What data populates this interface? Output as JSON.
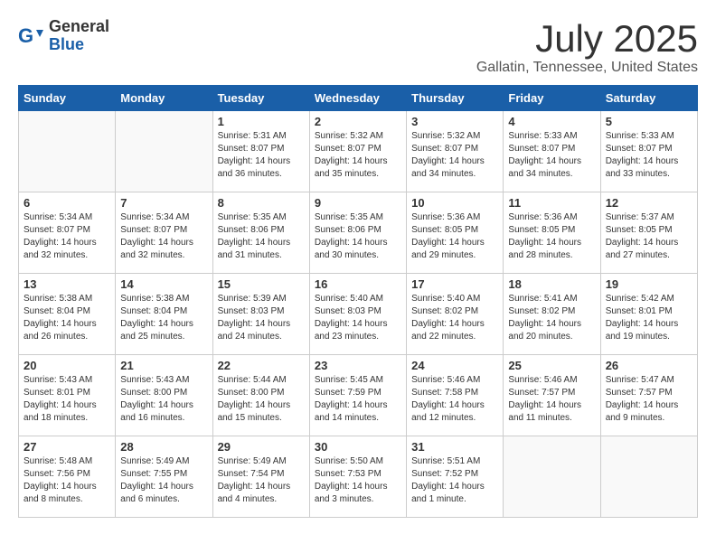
{
  "header": {
    "logo_general": "General",
    "logo_blue": "Blue",
    "month_year": "July 2025",
    "location": "Gallatin, Tennessee, United States"
  },
  "days_of_week": [
    "Sunday",
    "Monday",
    "Tuesday",
    "Wednesday",
    "Thursday",
    "Friday",
    "Saturday"
  ],
  "weeks": [
    [
      {
        "day": "",
        "detail": ""
      },
      {
        "day": "",
        "detail": ""
      },
      {
        "day": "1",
        "detail": "Sunrise: 5:31 AM\nSunset: 8:07 PM\nDaylight: 14 hours and 36 minutes."
      },
      {
        "day": "2",
        "detail": "Sunrise: 5:32 AM\nSunset: 8:07 PM\nDaylight: 14 hours and 35 minutes."
      },
      {
        "day": "3",
        "detail": "Sunrise: 5:32 AM\nSunset: 8:07 PM\nDaylight: 14 hours and 34 minutes."
      },
      {
        "day": "4",
        "detail": "Sunrise: 5:33 AM\nSunset: 8:07 PM\nDaylight: 14 hours and 34 minutes."
      },
      {
        "day": "5",
        "detail": "Sunrise: 5:33 AM\nSunset: 8:07 PM\nDaylight: 14 hours and 33 minutes."
      }
    ],
    [
      {
        "day": "6",
        "detail": "Sunrise: 5:34 AM\nSunset: 8:07 PM\nDaylight: 14 hours and 32 minutes."
      },
      {
        "day": "7",
        "detail": "Sunrise: 5:34 AM\nSunset: 8:07 PM\nDaylight: 14 hours and 32 minutes."
      },
      {
        "day": "8",
        "detail": "Sunrise: 5:35 AM\nSunset: 8:06 PM\nDaylight: 14 hours and 31 minutes."
      },
      {
        "day": "9",
        "detail": "Sunrise: 5:35 AM\nSunset: 8:06 PM\nDaylight: 14 hours and 30 minutes."
      },
      {
        "day": "10",
        "detail": "Sunrise: 5:36 AM\nSunset: 8:05 PM\nDaylight: 14 hours and 29 minutes."
      },
      {
        "day": "11",
        "detail": "Sunrise: 5:36 AM\nSunset: 8:05 PM\nDaylight: 14 hours and 28 minutes."
      },
      {
        "day": "12",
        "detail": "Sunrise: 5:37 AM\nSunset: 8:05 PM\nDaylight: 14 hours and 27 minutes."
      }
    ],
    [
      {
        "day": "13",
        "detail": "Sunrise: 5:38 AM\nSunset: 8:04 PM\nDaylight: 14 hours and 26 minutes."
      },
      {
        "day": "14",
        "detail": "Sunrise: 5:38 AM\nSunset: 8:04 PM\nDaylight: 14 hours and 25 minutes."
      },
      {
        "day": "15",
        "detail": "Sunrise: 5:39 AM\nSunset: 8:03 PM\nDaylight: 14 hours and 24 minutes."
      },
      {
        "day": "16",
        "detail": "Sunrise: 5:40 AM\nSunset: 8:03 PM\nDaylight: 14 hours and 23 minutes."
      },
      {
        "day": "17",
        "detail": "Sunrise: 5:40 AM\nSunset: 8:02 PM\nDaylight: 14 hours and 22 minutes."
      },
      {
        "day": "18",
        "detail": "Sunrise: 5:41 AM\nSunset: 8:02 PM\nDaylight: 14 hours and 20 minutes."
      },
      {
        "day": "19",
        "detail": "Sunrise: 5:42 AM\nSunset: 8:01 PM\nDaylight: 14 hours and 19 minutes."
      }
    ],
    [
      {
        "day": "20",
        "detail": "Sunrise: 5:43 AM\nSunset: 8:01 PM\nDaylight: 14 hours and 18 minutes."
      },
      {
        "day": "21",
        "detail": "Sunrise: 5:43 AM\nSunset: 8:00 PM\nDaylight: 14 hours and 16 minutes."
      },
      {
        "day": "22",
        "detail": "Sunrise: 5:44 AM\nSunset: 8:00 PM\nDaylight: 14 hours and 15 minutes."
      },
      {
        "day": "23",
        "detail": "Sunrise: 5:45 AM\nSunset: 7:59 PM\nDaylight: 14 hours and 14 minutes."
      },
      {
        "day": "24",
        "detail": "Sunrise: 5:46 AM\nSunset: 7:58 PM\nDaylight: 14 hours and 12 minutes."
      },
      {
        "day": "25",
        "detail": "Sunrise: 5:46 AM\nSunset: 7:57 PM\nDaylight: 14 hours and 11 minutes."
      },
      {
        "day": "26",
        "detail": "Sunrise: 5:47 AM\nSunset: 7:57 PM\nDaylight: 14 hours and 9 minutes."
      }
    ],
    [
      {
        "day": "27",
        "detail": "Sunrise: 5:48 AM\nSunset: 7:56 PM\nDaylight: 14 hours and 8 minutes."
      },
      {
        "day": "28",
        "detail": "Sunrise: 5:49 AM\nSunset: 7:55 PM\nDaylight: 14 hours and 6 minutes."
      },
      {
        "day": "29",
        "detail": "Sunrise: 5:49 AM\nSunset: 7:54 PM\nDaylight: 14 hours and 4 minutes."
      },
      {
        "day": "30",
        "detail": "Sunrise: 5:50 AM\nSunset: 7:53 PM\nDaylight: 14 hours and 3 minutes."
      },
      {
        "day": "31",
        "detail": "Sunrise: 5:51 AM\nSunset: 7:52 PM\nDaylight: 14 hours and 1 minute."
      },
      {
        "day": "",
        "detail": ""
      },
      {
        "day": "",
        "detail": ""
      }
    ]
  ]
}
